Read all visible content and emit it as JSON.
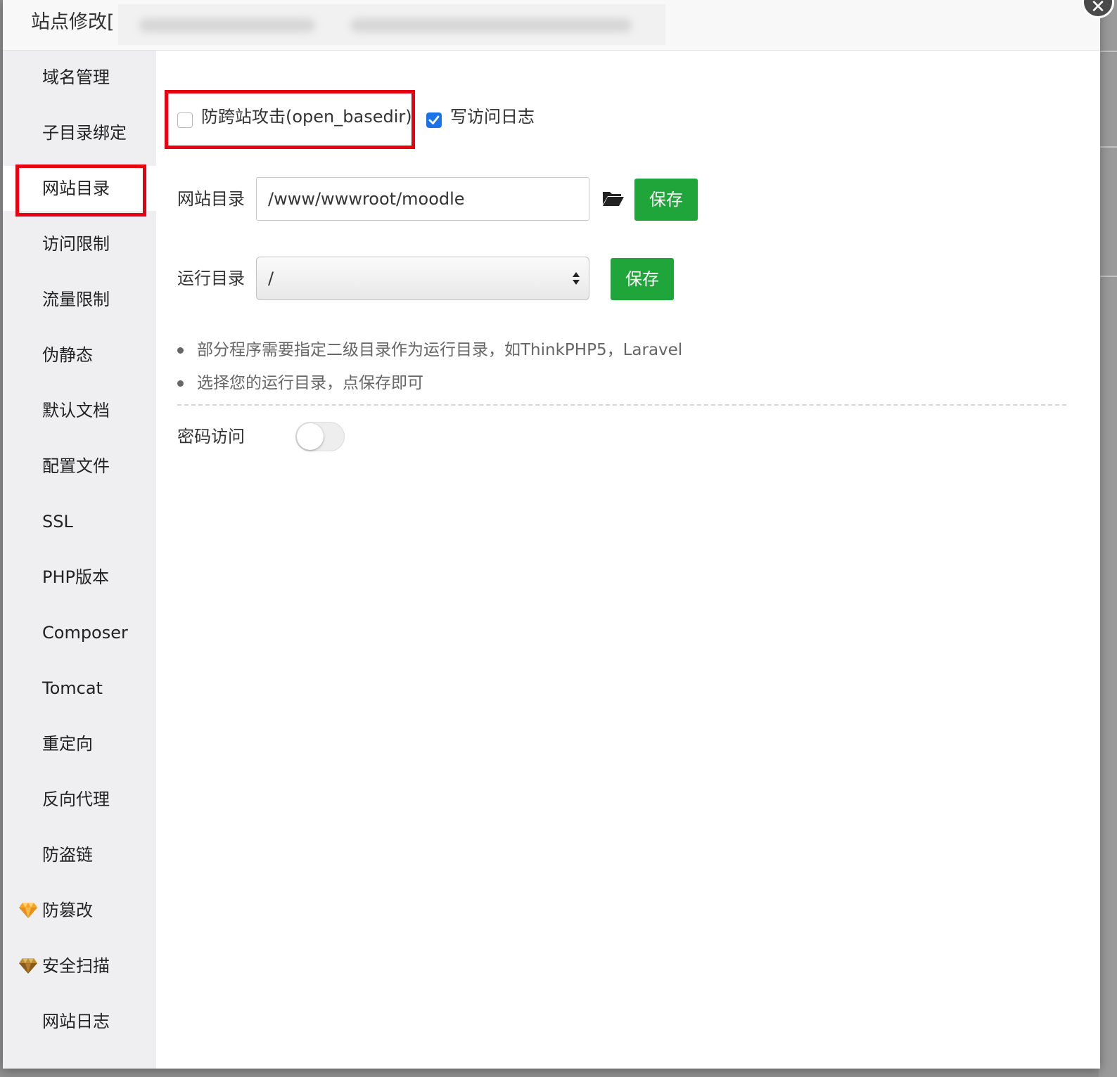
{
  "dialog": {
    "title": "站点修改[",
    "close_icon": "close-icon"
  },
  "sidebar": {
    "items": [
      {
        "label": "域名管理"
      },
      {
        "label": "子目录绑定"
      },
      {
        "label": "网站目录",
        "active": true
      },
      {
        "label": "访问限制"
      },
      {
        "label": "流量限制"
      },
      {
        "label": "伪静态"
      },
      {
        "label": "默认文档"
      },
      {
        "label": "配置文件"
      },
      {
        "label": "SSL"
      },
      {
        "label": "PHP版本"
      },
      {
        "label": "Composer"
      },
      {
        "label": "Tomcat"
      },
      {
        "label": "重定向"
      },
      {
        "label": "反向代理"
      },
      {
        "label": "防盗链"
      },
      {
        "label": "防篡改",
        "icon": "diamond-icon"
      },
      {
        "label": "安全扫描",
        "icon": "diamond-icon"
      },
      {
        "label": "网站日志"
      }
    ]
  },
  "main": {
    "open_basedir_label": "防跨站攻击(open_basedir)",
    "open_basedir_checked": false,
    "access_log_label": "写访问日志",
    "access_log_checked": true,
    "site_dir_label": "网站目录",
    "site_dir_value": "/www/wwwroot/moodle",
    "save_label": "保存",
    "run_dir_label": "运行目录",
    "run_dir_value": "/",
    "tips": [
      "部分程序需要指定二级目录作为运行目录，如ThinkPHP5，Laravel",
      "选择您的运行目录，点保存即可"
    ],
    "password_access_label": "密码访问",
    "password_access_enabled": false
  },
  "colors": {
    "accent_green": "#20a53a",
    "checkbox_blue": "#1a73e8",
    "highlight_red": "#e60012"
  }
}
